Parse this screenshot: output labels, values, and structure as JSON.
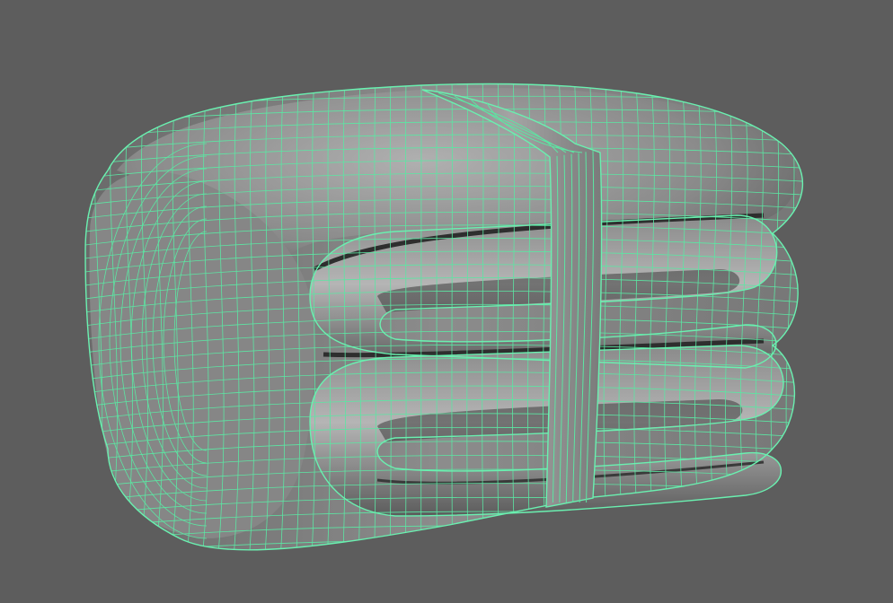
{
  "viewport": {
    "background": "#5d5d5d",
    "wireframe_color": "#5ce6a3",
    "shading_light": "#a8a8a8",
    "shading_dark": "#4a4a4a",
    "shading_mode": "smooth-shaded-with-wireframe",
    "object": "folded-blanket-mesh-with-strap"
  }
}
